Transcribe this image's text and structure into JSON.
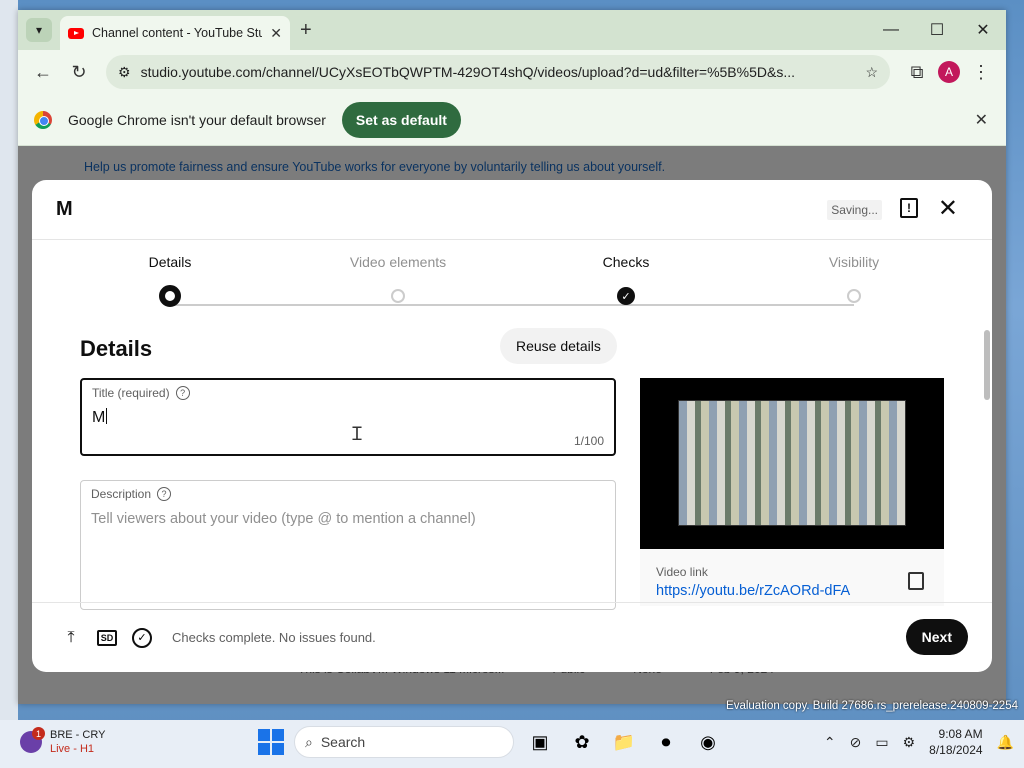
{
  "browser": {
    "tab_title": "Channel content - YouTube Stu",
    "url": "studio.youtube.com/channel/UCyXsEOTbQWPTM-429OT4shQ/videos/upload?d=ud&filter=%5B%5D&s...",
    "profile_initial": "A",
    "infobar": {
      "message": "Google Chrome isn't your default browser",
      "button": "Set as default"
    }
  },
  "studio_background": {
    "promo": "Help us promote fairness and ensure YouTube works for everyone by voluntarily telling us about yourself.",
    "row_title": "This is CollabVM Windows 11 Micros...",
    "row_visibility": "Public",
    "row_restrictions": "None",
    "row_date": "Feb 9, 2024"
  },
  "modal": {
    "title": "M",
    "saving": "Saving...",
    "steps": [
      {
        "label": "Details",
        "state": "current"
      },
      {
        "label": "Video elements",
        "state": "pending"
      },
      {
        "label": "Checks",
        "state": "done"
      },
      {
        "label": "Visibility",
        "state": "pending"
      }
    ],
    "section_title": "Details",
    "reuse_button": "Reuse details",
    "title_field": {
      "label": "Title (required)",
      "value": "M",
      "counter": "1/100"
    },
    "description_field": {
      "label": "Description",
      "placeholder": "Tell viewers about your video (type @ to mention a channel)"
    },
    "preview": {
      "link_label": "Video link",
      "link": "https://youtu.be/rZcAORd-dFA"
    },
    "footer": {
      "sd_badge": "SD",
      "status": "Checks complete. No issues found.",
      "next_button": "Next"
    }
  },
  "overlay": {
    "eval_text": "Evaluation copy. Build 27686.rs_prerelease.240809-2254"
  },
  "taskbar": {
    "news_title": "BRE - CRY",
    "news_sub": "Live - H1",
    "news_badge": "1",
    "search_label": "Search",
    "time": "9:08 AM",
    "date": "8/18/2024"
  }
}
